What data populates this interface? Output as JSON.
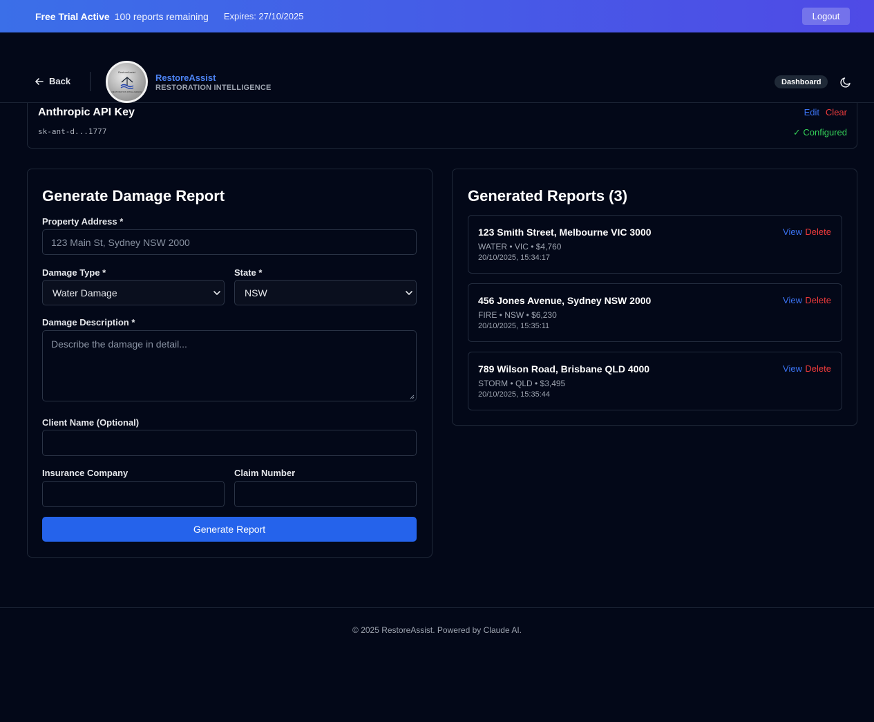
{
  "trial": {
    "status": "Free Trial Active",
    "remaining": "100 reports remaining",
    "expires": "Expires: 27/10/2025",
    "logout_label": "Logout"
  },
  "header": {
    "back_label": "Back",
    "brand_name": "RestoreAssist",
    "brand_tagline": "RESTORATION INTELLIGENCE",
    "logo_top_text": "RestoreAssist",
    "logo_bottom_text": "RESTORATION INTELLIGENCE",
    "dashboard_label": "Dashboard",
    "theme_icon": "moon-icon"
  },
  "api_key": {
    "title": "Anthropic API Key",
    "value": "sk-ant-d...1777",
    "edit_label": "Edit",
    "clear_label": "Clear",
    "status": "✓ Configured"
  },
  "form": {
    "title": "Generate Damage Report",
    "address_label": "Property Address *",
    "address_placeholder": "123 Main St, Sydney NSW 2000",
    "damage_type_label": "Damage Type *",
    "damage_type_value": "Water Damage",
    "state_label": "State *",
    "state_value": "NSW",
    "description_label": "Damage Description *",
    "description_placeholder": "Describe the damage in detail...",
    "client_label": "Client Name (Optional)",
    "insurance_label": "Insurance Company",
    "claim_label": "Claim Number",
    "submit_label": "Generate Report"
  },
  "reports": {
    "title": "Generated Reports (3)",
    "view_label": "View",
    "delete_label": "Delete",
    "items": [
      {
        "address": "123 Smith Street, Melbourne VIC 3000",
        "meta": "WATER • VIC • $4,760",
        "time": "20/10/2025, 15:34:17"
      },
      {
        "address": "456 Jones Avenue, Sydney NSW 2000",
        "meta": "FIRE • NSW • $6,230",
        "time": "20/10/2025, 15:35:11"
      },
      {
        "address": "789 Wilson Road, Brisbane QLD 4000",
        "meta": "STORM • QLD • $3,495",
        "time": "20/10/2025, 15:35:44"
      }
    ]
  },
  "footer": {
    "text": "© 2025 RestoreAssist. Powered by Claude AI."
  }
}
